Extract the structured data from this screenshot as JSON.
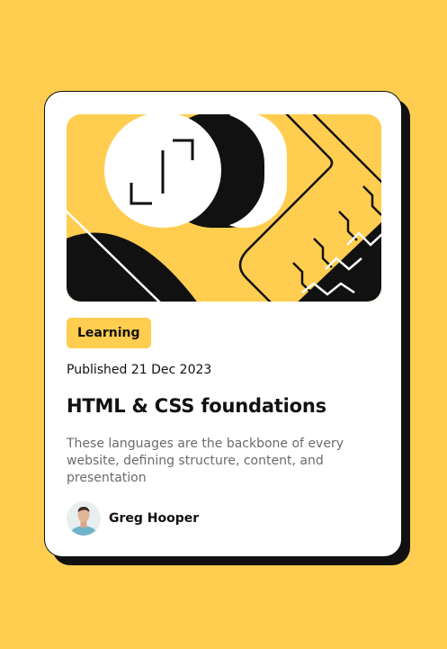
{
  "card": {
    "tag": "Learning",
    "published": "Published 21 Dec 2023",
    "title": "HTML & CSS foundations",
    "description": "These languages are the backbone of every website, defining structure, content, and presentation",
    "author": {
      "name": "Greg Hooper",
      "avatar_icon": "avatar-photo"
    },
    "hero_icon": "abstract-illustration"
  },
  "colors": {
    "background": "#FFCD4F",
    "card": "#FFFFFF",
    "ink": "#111111",
    "muted": "#6B6B6B"
  }
}
